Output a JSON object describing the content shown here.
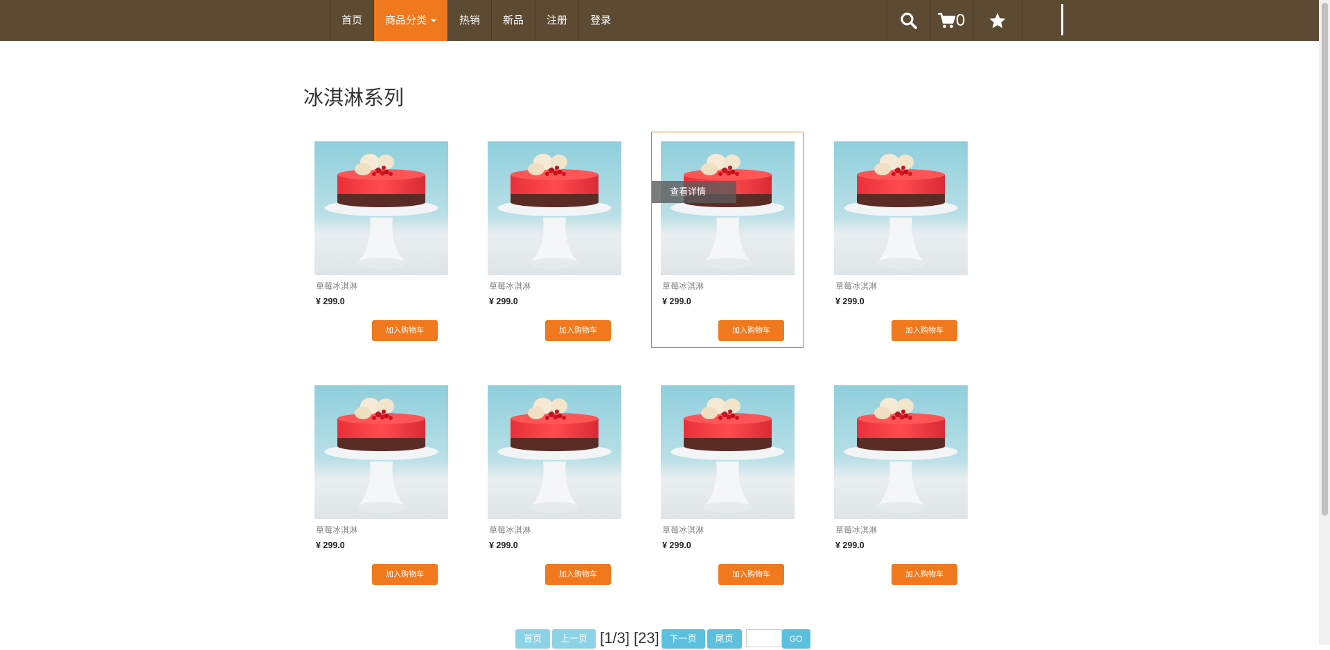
{
  "nav": {
    "items": [
      {
        "label": "首页",
        "active": false
      },
      {
        "label": "商品分类",
        "active": true,
        "dropdown": true
      },
      {
        "label": "热销",
        "active": false
      },
      {
        "label": "新品",
        "active": false
      },
      {
        "label": "注册",
        "active": false
      },
      {
        "label": "登录",
        "active": false
      }
    ],
    "cart_count": "0",
    "icons": [
      "search-icon",
      "cart-icon",
      "star-icon"
    ]
  },
  "page": {
    "title": "冰淇淋系列"
  },
  "products": [
    {
      "name": "草莓冰淇淋",
      "price": "¥ 299.0",
      "button": "加入购物车"
    },
    {
      "name": "草莓冰淇淋",
      "price": "¥ 299.0",
      "button": "加入购物车"
    },
    {
      "name": "草莓冰淇淋",
      "price": "¥ 299.0",
      "button": "加入购物车",
      "hover_label": "查看详情"
    },
    {
      "name": "草莓冰淇淋",
      "price": "¥ 299.0",
      "button": "加入购物车"
    },
    {
      "name": "草莓冰淇淋",
      "price": "¥ 299.0",
      "button": "加入购物车"
    },
    {
      "name": "草莓冰淇淋",
      "price": "¥ 299.0",
      "button": "加入购物车"
    },
    {
      "name": "草莓冰淇淋",
      "price": "¥ 299.0",
      "button": "加入购物车"
    },
    {
      "name": "草莓冰淇淋",
      "price": "¥ 299.0",
      "button": "加入购物车"
    }
  ],
  "pagination": {
    "first": "首页",
    "prev": "上一页",
    "current": "[1/3]",
    "page_link": "[23]",
    "next": "下一页",
    "last": "尾页",
    "go": "GO"
  },
  "colors": {
    "nav_bg": "#5c4a33",
    "accent": "#f0791e",
    "pager": "#5bc0de"
  }
}
